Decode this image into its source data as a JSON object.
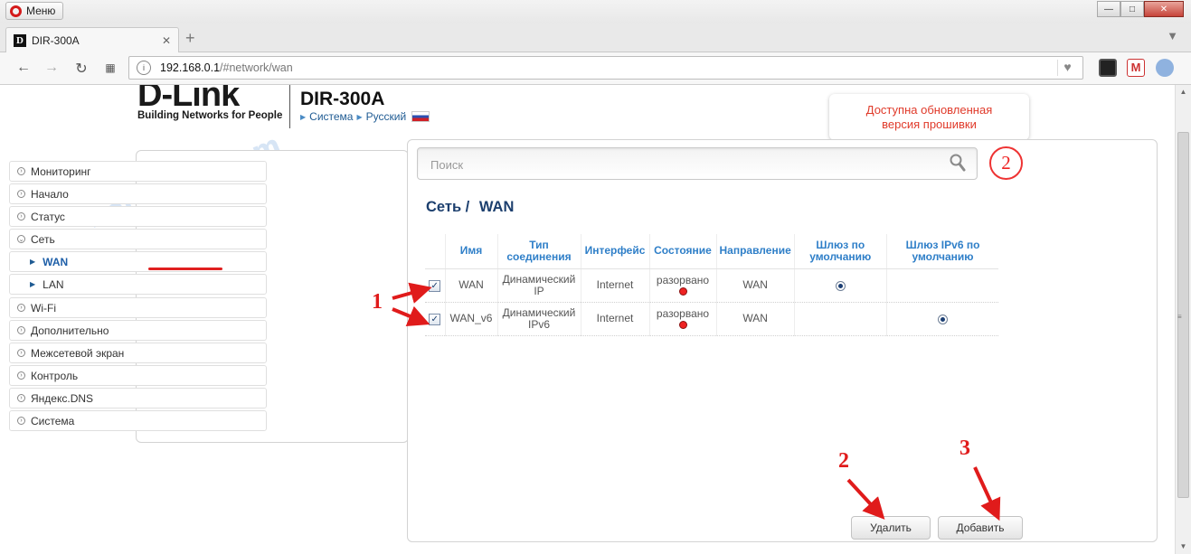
{
  "browser": {
    "menu_label": "Меню",
    "tab_title": "DIR-300A",
    "tab_favicon": "D",
    "address_host": "192.168.0.1",
    "address_path": "/#network/wan"
  },
  "header": {
    "logo_text": "D-Link",
    "logo_tagline": "Building Networks for People",
    "model": "DIR-300A",
    "link_system": "Система",
    "link_language": "Русский"
  },
  "notice": {
    "line1": "Доступна обновленная",
    "line2": "версия прошивки"
  },
  "search": {
    "placeholder": "Поиск"
  },
  "breadcrumb": {
    "section": "Сеть /",
    "page": "WAN"
  },
  "sidebar": {
    "items": [
      {
        "label": "Мониторинг"
      },
      {
        "label": "Начало"
      },
      {
        "label": "Статус"
      },
      {
        "label": "Сеть"
      },
      {
        "label": "WAN"
      },
      {
        "label": "LAN"
      },
      {
        "label": "Wi-Fi"
      },
      {
        "label": "Дополнительно"
      },
      {
        "label": "Межсетевой экран"
      },
      {
        "label": "Контроль"
      },
      {
        "label": "Яндекс.DNS"
      },
      {
        "label": "Система"
      }
    ]
  },
  "table": {
    "headers": [
      "Имя",
      "Тип соединения",
      "Интерфейс",
      "Состояние",
      "Направление",
      "Шлюз по умолчанию",
      "Шлюз IPv6 по умолчанию"
    ],
    "rows": [
      {
        "name": "WAN",
        "type": "Динамический IP",
        "iface": "Internet",
        "state": "разорвано",
        "direction": "WAN"
      },
      {
        "name": "WAN_v6",
        "type": "Динамический IPv6",
        "iface": "Internet",
        "state": "разорвано",
        "direction": "WAN"
      }
    ]
  },
  "buttons": {
    "delete": "Удалить",
    "add": "Добавить"
  },
  "annotations": {
    "a1": "1",
    "a2_circle": "2",
    "a2": "2",
    "a3": "3"
  },
  "watermark": "help-wifi.com",
  "colors": {
    "accent": "#2f7fc8",
    "annotation": "#e01b1b",
    "notice": "#e03a2a"
  }
}
